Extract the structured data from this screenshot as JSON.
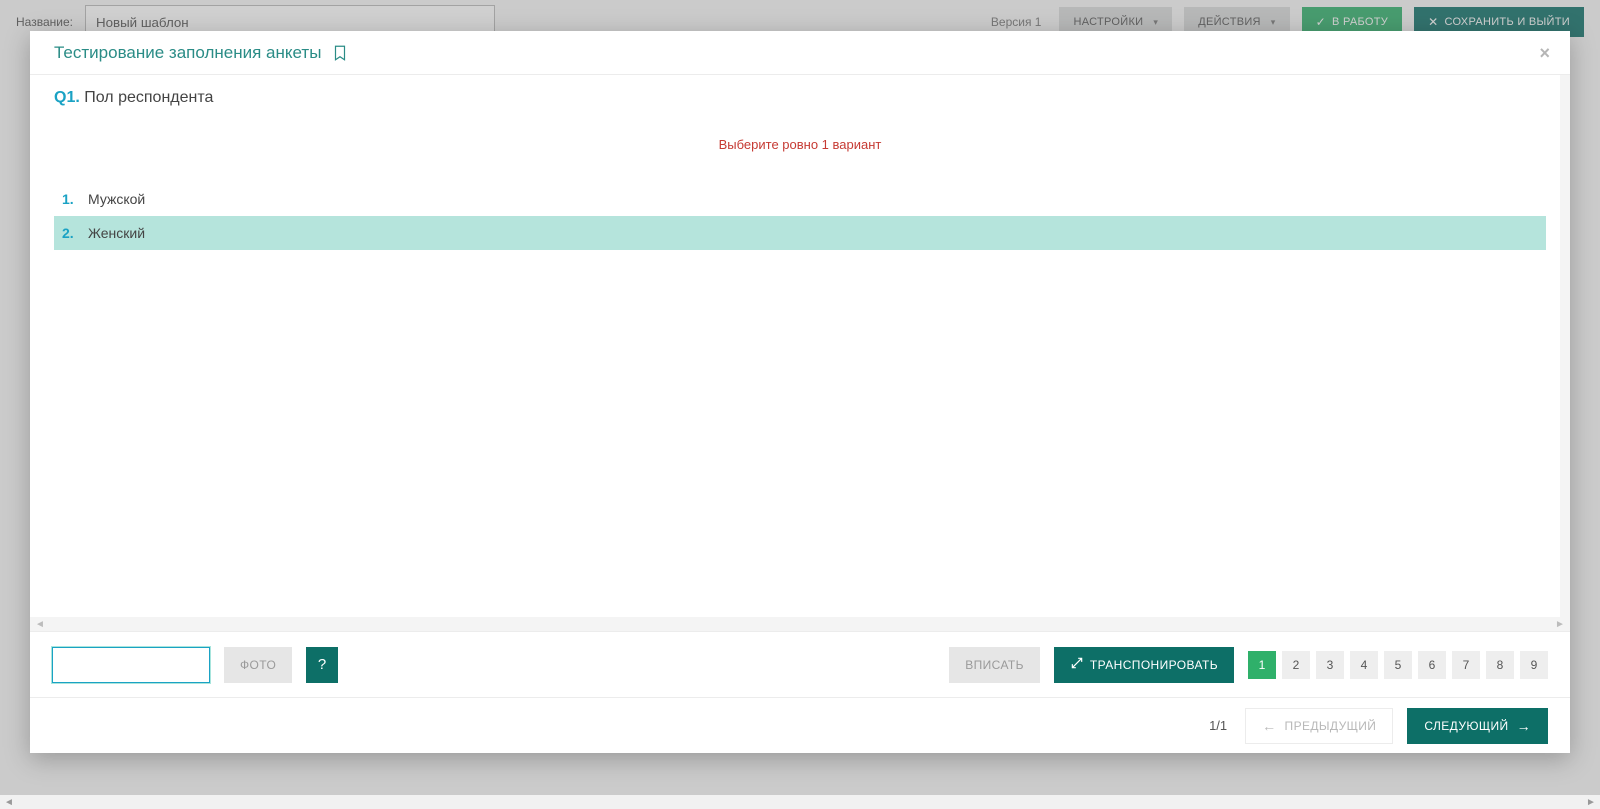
{
  "background": {
    "name_label": "Название:",
    "name_value": "Новый шаблон",
    "version": "Версия 1",
    "settings_btn": "НАСТРОЙКИ",
    "actions_btn": "ДЕЙСТВИЯ",
    "start_btn": "В РАБОТУ",
    "save_exit_btn": "СОХРАНИТЬ И ВЫЙТИ"
  },
  "modal": {
    "title": "Тестирование заполнения анкеты",
    "question_code": "Q1.",
    "question_text": "Пол респондента",
    "validation_msg": "Выберите ровно 1 вариант",
    "options": [
      {
        "num": "1.",
        "label": "Мужской",
        "selected": false
      },
      {
        "num": "2.",
        "label": "Женский",
        "selected": true
      }
    ]
  },
  "toolbar": {
    "answer_value": "",
    "photo_btn": "ФОТО",
    "help_btn": "?",
    "fit_btn": "ВПИСАТЬ",
    "transpose_btn": "ТРАНСПОНИРОВАТЬ",
    "pager": {
      "active": 1,
      "buttons": [
        "1",
        "2",
        "3",
        "4",
        "5",
        "6",
        "7",
        "8",
        "9"
      ]
    }
  },
  "footer": {
    "page_indicator": "1/1",
    "prev_btn": "ПРЕДЫДУЩИЙ",
    "next_btn": "СЛЕДУЮЩИЙ"
  }
}
